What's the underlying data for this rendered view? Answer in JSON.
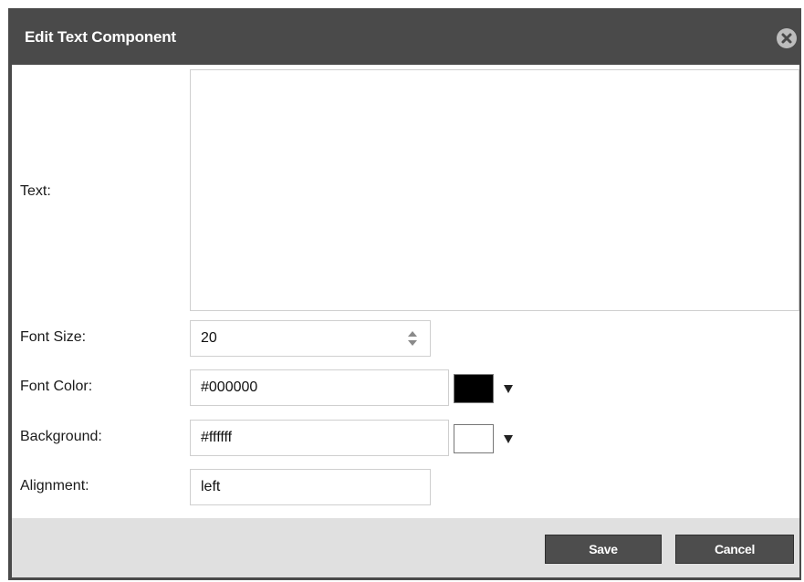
{
  "dialog": {
    "title": "Edit Text Component",
    "close_icon": "close-circle-x-icon"
  },
  "form": {
    "text": {
      "label": "Text:",
      "value": ""
    },
    "font_size": {
      "label": "Font Size:",
      "value": "20"
    },
    "font_color": {
      "label": "Font Color:",
      "value": "#000000",
      "swatch_color": "#000000"
    },
    "background": {
      "label": "Background:",
      "value": "#ffffff",
      "swatch_color": "#ffffff"
    },
    "alignment": {
      "label": "Alignment:",
      "value": "left"
    }
  },
  "footer": {
    "save_label": "Save",
    "cancel_label": "Cancel"
  },
  "colors": {
    "titlebar": "#4a4a4a",
    "footer": "#e0e0e0",
    "button": "#4d4d4d"
  }
}
